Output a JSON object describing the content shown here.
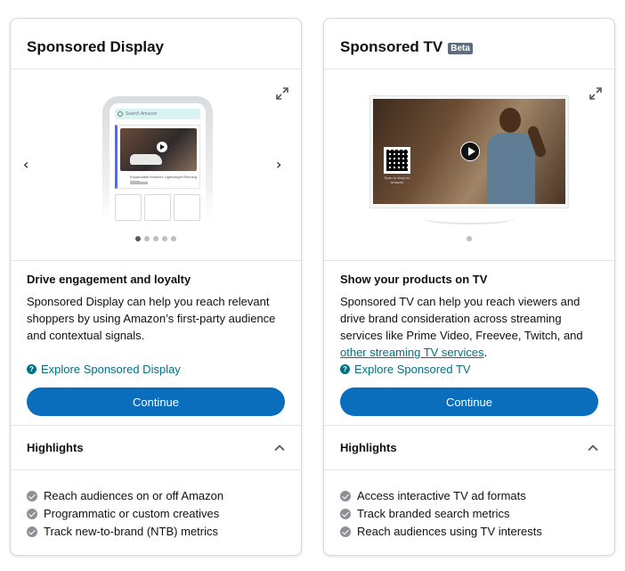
{
  "cards": [
    {
      "title": "Sponsored Display",
      "badge": "",
      "carousel": {
        "slides": 5,
        "active": 0
      },
      "phone_search_placeholder": "Search Amazon",
      "phone_ad_text": "Expandable Moisture Lightweight Running Shoes",
      "heading": "Drive engagement and loyalty",
      "description": "Sponsored Display can help you reach relevant shoppers by using Amazon’s first-party audience and contextual signals.",
      "link_tail": "",
      "link_after": "",
      "explore": "Explore Sponsored Display",
      "continue": "Continue",
      "highlights_title": "Highlights",
      "highlights": [
        "Reach audiences on or off Amazon",
        "Programmatic or custom creatives",
        "Track new-to-brand (NTB) metrics"
      ]
    },
    {
      "title": "Sponsored TV",
      "badge": "Beta",
      "carousel": {
        "slides": 1,
        "active": 0
      },
      "tv_qr_text": "Scan to shop on Amazon",
      "heading": "Show your products on TV",
      "description": "Sponsored TV can help you reach viewers and drive brand consideration across streaming services like Prime Video, Freevee, Twitch, and ",
      "link_tail": "other streaming TV services",
      "link_after": ".",
      "explore": "Explore Sponsored TV",
      "continue": "Continue",
      "highlights_title": "Highlights",
      "highlights": [
        "Access interactive TV ad formats",
        "Track branded search metrics",
        "Reach audiences using TV interests"
      ]
    }
  ],
  "colors": {
    "link": "#007185",
    "button": "#0a6ebd",
    "check": "#8d9096",
    "badge": "#5d6d7e"
  }
}
